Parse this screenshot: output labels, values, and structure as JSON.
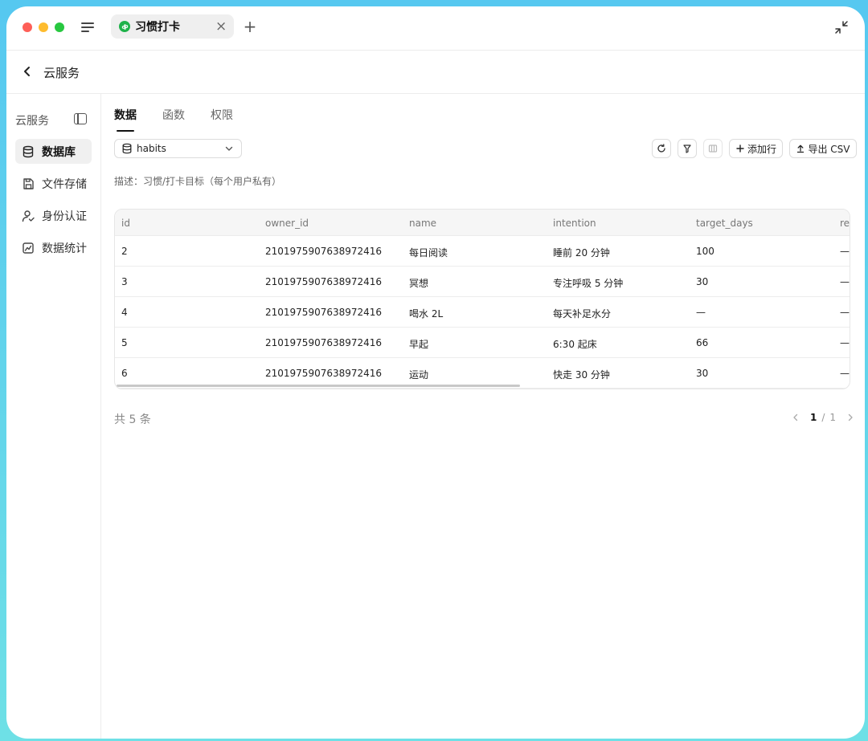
{
  "window": {
    "tab_title": "习惯打卡",
    "tab_close": "×",
    "tab_add": "+"
  },
  "header": {
    "title": "云服务"
  },
  "sidebar": {
    "title": "云服务",
    "items": [
      {
        "label": "数据库",
        "icon": "database-icon",
        "active": true
      },
      {
        "label": "文件存储",
        "icon": "storage-icon",
        "active": false
      },
      {
        "label": "身份认证",
        "icon": "user-auth-icon",
        "active": false
      },
      {
        "label": "数据统计",
        "icon": "chart-icon",
        "active": false
      }
    ]
  },
  "main": {
    "tabs": [
      {
        "label": "数据",
        "active": true
      },
      {
        "label": "函数",
        "active": false
      },
      {
        "label": "权限",
        "active": false
      }
    ],
    "table_select": {
      "value": "habits"
    },
    "toolbar": {
      "add_row_label": "添加行",
      "export_label": "导出 CSV"
    },
    "description": "描述：习惯/打卡目标（每个用户私有）",
    "table": {
      "columns": [
        "id",
        "owner_id",
        "name",
        "intention",
        "target_days",
        "re"
      ],
      "rows": [
        [
          "2",
          "2101975907638972416",
          "每日阅读",
          "睡前 20 分钟",
          "100",
          "—"
        ],
        [
          "3",
          "2101975907638972416",
          "冥想",
          "专注呼吸 5 分钟",
          "30",
          "—"
        ],
        [
          "4",
          "2101975907638972416",
          "喝水 2L",
          "每天补足水分",
          "—",
          "—"
        ],
        [
          "5",
          "2101975907638972416",
          "早起",
          "6:30 起床",
          "66",
          "—"
        ],
        [
          "6",
          "2101975907638972416",
          "运动",
          "快走 30 分钟",
          "30",
          "—"
        ]
      ]
    },
    "total": "共 5 条",
    "pagination": {
      "current": "1",
      "separator": "/",
      "total": "1"
    }
  },
  "colors": {
    "tab_icon": "#1fb24a",
    "traffic_red": "#fe5f57",
    "traffic_yellow": "#febc2e",
    "traffic_green": "#28c840"
  }
}
